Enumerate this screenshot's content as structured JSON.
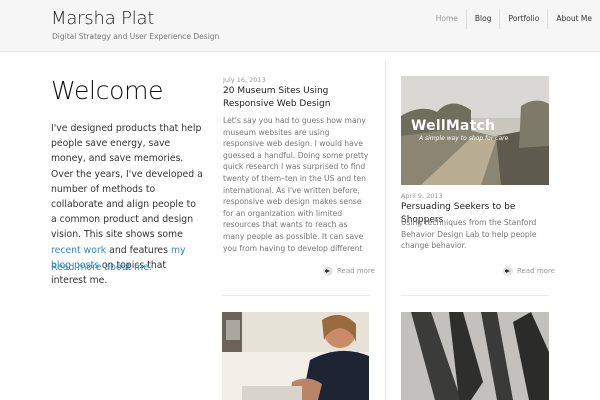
{
  "site": {
    "title": "Marsha Plat",
    "tagline": "Digital Strategy and User Experience Design"
  },
  "nav": {
    "items": [
      {
        "label": "Home"
      },
      {
        "label": "Blog"
      },
      {
        "label": "Portfolio"
      },
      {
        "label": "About Me"
      }
    ]
  },
  "intro": {
    "heading": "Welcome",
    "text_1": "I've designed products that help people save energy, save money, and save memories. Over the years, I've developed a number of methods to collaborate and align people to a common product and design vision. This site shows some",
    "recent_work_link": "recent work",
    "text_2": "and features",
    "blog_link": "my blog posts",
    "text_3": "on topics that interest me.",
    "read_more_about": "Read more about me."
  },
  "posts": [
    {
      "date": "July 16, 2013",
      "title": "20 Museum Sites Using Responsive Web Design",
      "excerpt": "Let's say you had to guess how many museum websites are using responsive web design. I would have guessed a handful. Doing some pretty quick research I was surprised to find twenty of them–ten in the US and ten international. As I've written before, responsive web design makes sense for an organization with limited resources that wants to reach as many people as possible. It can save you from having to develop different apps for different devices and having your content",
      "read_more": "Read more"
    },
    {
      "date": "April 9, 2013",
      "title": "Persuading Seekers to be Shoppers",
      "excerpt": "Using techniques from the Stanford Behavior Design Lab to help people change behavior.",
      "read_more": "Read more",
      "image": {
        "brand": "WellMatch",
        "slogan": "A simple way to shop for care"
      }
    }
  ],
  "icons": {
    "read_more": "arrow-right-circle-icon"
  },
  "colors": {
    "link": "#2d8ac6",
    "header_bg": "#f6f6f6"
  }
}
